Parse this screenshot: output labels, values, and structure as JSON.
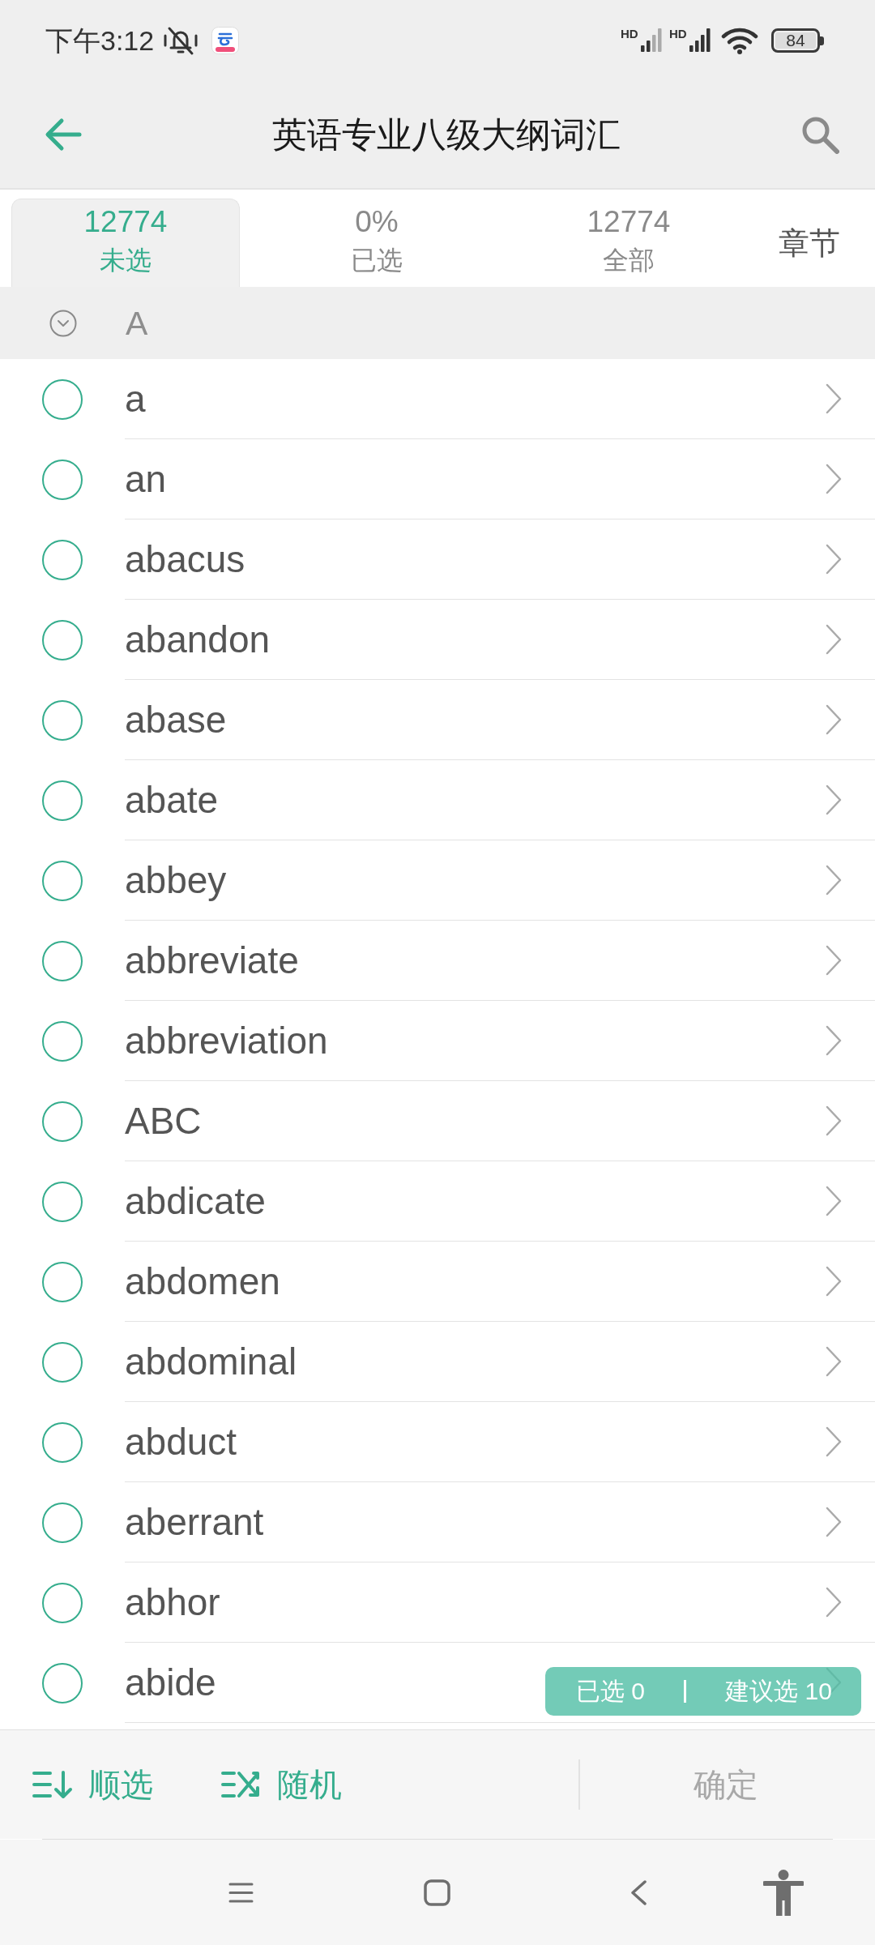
{
  "status_bar": {
    "time": "下午3:12",
    "signals": [
      {
        "label": "HD"
      },
      {
        "label": "HD"
      }
    ],
    "battery": "84"
  },
  "header": {
    "title": "英语专业八级大纲词汇"
  },
  "tabs": [
    {
      "kind": "count",
      "value": "12774",
      "label": "未选",
      "selected": true
    },
    {
      "kind": "count",
      "value": "0%",
      "label": "已选",
      "selected": false
    },
    {
      "kind": "count",
      "value": "12774",
      "label": "全部",
      "selected": false
    },
    {
      "kind": "plain",
      "label": "章节",
      "selected": false
    }
  ],
  "section": {
    "letter": "A",
    "expanded": true
  },
  "words": [
    {
      "word": "a",
      "checked": false
    },
    {
      "word": "an",
      "checked": false
    },
    {
      "word": "abacus",
      "checked": false
    },
    {
      "word": "abandon",
      "checked": false
    },
    {
      "word": "abase",
      "checked": false
    },
    {
      "word": "abate",
      "checked": false
    },
    {
      "word": "abbey",
      "checked": false
    },
    {
      "word": "abbreviate",
      "checked": false
    },
    {
      "word": "abbreviation",
      "checked": false
    },
    {
      "word": "ABC",
      "checked": false
    },
    {
      "word": "abdicate",
      "checked": false
    },
    {
      "word": "abdomen",
      "checked": false
    },
    {
      "word": "abdominal",
      "checked": false
    },
    {
      "word": "abduct",
      "checked": false
    },
    {
      "word": "aberrant",
      "checked": false
    },
    {
      "word": "abhor",
      "checked": false
    },
    {
      "word": "abide",
      "checked": false
    }
  ],
  "summary": {
    "selected": "已选 0",
    "suggested": "建议选 10"
  },
  "toolbar": {
    "buttons": [
      {
        "kind": "sequential",
        "label": "顺选"
      },
      {
        "kind": "random",
        "label": "随机"
      }
    ],
    "confirm": {
      "label": "确定",
      "disabled": true
    }
  }
}
